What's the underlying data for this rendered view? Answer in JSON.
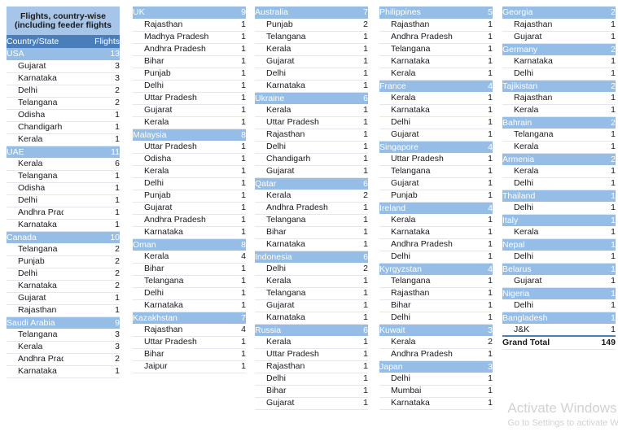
{
  "table": {
    "title_line_1": "Flights, country-wise",
    "title_line_2": "(including feeder flights",
    "header": {
      "label": "Country/State",
      "value": "Flights"
    },
    "grand_total": {
      "label": "Grand Total",
      "value": "149"
    },
    "colors": {
      "title_band": "#A7C5E8",
      "header_band": "#4A7EBB",
      "group_band": "#95BDE5",
      "detail_bg": "#FFFFFF",
      "row_rule": "#E3E8EE",
      "total_rule": "#4A7EBB",
      "watermark": "#D2D2D2"
    }
  },
  "watermark": {
    "line1": "Activate Windows",
    "line2": "Go to Settings to activate Windows."
  },
  "chart_data": {
    "type": "table",
    "title": "Flights, country-wise (including feeder flights",
    "columns": [
      "Country/State",
      "Flights"
    ],
    "grand_total": 149,
    "groups": [
      {
        "country": "USA",
        "total": 13,
        "states": [
          {
            "state": "Gujarat",
            "flights": 3
          },
          {
            "state": "Karnataka",
            "flights": 3
          },
          {
            "state": "Delhi",
            "flights": 2
          },
          {
            "state": "Telangana",
            "flights": 2
          },
          {
            "state": "Odisha",
            "flights": 1
          },
          {
            "state": "Chandigarh",
            "flights": 1
          },
          {
            "state": "Kerala",
            "flights": 1
          }
        ]
      },
      {
        "country": "UAE",
        "total": 11,
        "states": [
          {
            "state": "Kerala",
            "flights": 6
          },
          {
            "state": "Telangana",
            "flights": 1
          },
          {
            "state": "Odisha",
            "flights": 1
          },
          {
            "state": "Delhi",
            "flights": 1
          },
          {
            "state": "Andhra Pradesh",
            "flights": 1
          },
          {
            "state": "Karnataka",
            "flights": 1
          }
        ]
      },
      {
        "country": "Canada",
        "total": 10,
        "states": [
          {
            "state": "Telangana",
            "flights": 2
          },
          {
            "state": "Punjab",
            "flights": 2
          },
          {
            "state": "Delhi",
            "flights": 2
          },
          {
            "state": "Karnataka",
            "flights": 2
          },
          {
            "state": "Gujarat",
            "flights": 1
          },
          {
            "state": "Rajasthan",
            "flights": 1
          }
        ]
      },
      {
        "country": "Saudi Arabia",
        "total": 9,
        "states": [
          {
            "state": "Telangana",
            "flights": 3
          },
          {
            "state": "Kerala",
            "flights": 3
          },
          {
            "state": "Andhra Pradesh",
            "flights": 2
          },
          {
            "state": "Karnataka",
            "flights": 1
          }
        ]
      },
      {
        "country": "UK",
        "total": 9,
        "states": [
          {
            "state": "Rajasthan",
            "flights": 1
          },
          {
            "state": "Madhya Pradesh",
            "flights": 1
          },
          {
            "state": "Andhra Pradesh",
            "flights": 1
          },
          {
            "state": "Bihar",
            "flights": 1
          },
          {
            "state": "Punjab",
            "flights": 1
          },
          {
            "state": "Delhi",
            "flights": 1
          },
          {
            "state": "Uttar Pradesh",
            "flights": 1
          },
          {
            "state": "Gujarat",
            "flights": 1
          },
          {
            "state": "Kerala",
            "flights": 1
          }
        ]
      },
      {
        "country": "Malaysia",
        "total": 8,
        "states": [
          {
            "state": "Uttar Pradesh",
            "flights": 1
          },
          {
            "state": "Odisha",
            "flights": 1
          },
          {
            "state": "Kerala",
            "flights": 1
          },
          {
            "state": "Delhi",
            "flights": 1
          },
          {
            "state": "Punjab",
            "flights": 1
          },
          {
            "state": "Gujarat",
            "flights": 1
          },
          {
            "state": "Andhra Pradesh",
            "flights": 1
          },
          {
            "state": "Karnataka",
            "flights": 1
          }
        ]
      },
      {
        "country": "Oman",
        "total": 8,
        "states": [
          {
            "state": "Kerala",
            "flights": 4
          },
          {
            "state": "Bihar",
            "flights": 1
          },
          {
            "state": "Telangana",
            "flights": 1
          },
          {
            "state": "Delhi",
            "flights": 1
          },
          {
            "state": "Karnataka",
            "flights": 1
          }
        ]
      },
      {
        "country": "Kazakhstan",
        "total": 7,
        "states": [
          {
            "state": "Rajasthan",
            "flights": 4
          },
          {
            "state": "Uttar Pradesh",
            "flights": 1
          },
          {
            "state": "Bihar",
            "flights": 1
          },
          {
            "state": "Jaipur",
            "flights": 1
          }
        ]
      },
      {
        "country": "Australia",
        "total": 7,
        "states": [
          {
            "state": "Punjab",
            "flights": 2
          },
          {
            "state": "Telangana",
            "flights": 1
          },
          {
            "state": "Kerala",
            "flights": 1
          },
          {
            "state": "Gujarat",
            "flights": 1
          },
          {
            "state": "Delhi",
            "flights": 1
          },
          {
            "state": "Karnataka",
            "flights": 1
          }
        ]
      },
      {
        "country": "Ukraine",
        "total": 6,
        "states": [
          {
            "state": "Kerala",
            "flights": 1
          },
          {
            "state": "Uttar Pradesh",
            "flights": 1
          },
          {
            "state": "Rajasthan",
            "flights": 1
          },
          {
            "state": "Delhi",
            "flights": 1
          },
          {
            "state": "Chandigarh",
            "flights": 1
          },
          {
            "state": "Gujarat",
            "flights": 1
          }
        ]
      },
      {
        "country": "Qatar",
        "total": 6,
        "states": [
          {
            "state": "Kerala",
            "flights": 2
          },
          {
            "state": "Andhra Pradesh",
            "flights": 1
          },
          {
            "state": "Telangana",
            "flights": 1
          },
          {
            "state": "Bihar",
            "flights": 1
          },
          {
            "state": "Karnataka",
            "flights": 1
          }
        ]
      },
      {
        "country": "Indonesia",
        "total": 6,
        "states": [
          {
            "state": "Delhi",
            "flights": 2
          },
          {
            "state": "Kerala",
            "flights": 1
          },
          {
            "state": "Telangana",
            "flights": 1
          },
          {
            "state": "Gujarat",
            "flights": 1
          },
          {
            "state": "Karnataka",
            "flights": 1
          }
        ]
      },
      {
        "country": "Russia",
        "total": 6,
        "states": [
          {
            "state": "Kerala",
            "flights": 1
          },
          {
            "state": "Uttar Pradesh",
            "flights": 1
          },
          {
            "state": "Rajasthan",
            "flights": 1
          },
          {
            "state": "Delhi",
            "flights": 1
          },
          {
            "state": "Bihar",
            "flights": 1
          },
          {
            "state": "Gujarat",
            "flights": 1
          }
        ]
      },
      {
        "country": "Philippines",
        "total": 5,
        "states": [
          {
            "state": "Rajasthan",
            "flights": 1
          },
          {
            "state": "Andhra Pradesh",
            "flights": 1
          },
          {
            "state": "Telangana",
            "flights": 1
          },
          {
            "state": "Karnataka",
            "flights": 1
          },
          {
            "state": "Kerala",
            "flights": 1
          }
        ]
      },
      {
        "country": "France",
        "total": 4,
        "states": [
          {
            "state": "Kerala",
            "flights": 1
          },
          {
            "state": "Karnataka",
            "flights": 1
          },
          {
            "state": "Delhi",
            "flights": 1
          },
          {
            "state": "Gujarat",
            "flights": 1
          }
        ]
      },
      {
        "country": "Singapore",
        "total": 4,
        "states": [
          {
            "state": "Uttar Pradesh",
            "flights": 1
          },
          {
            "state": "Telangana",
            "flights": 1
          },
          {
            "state": "Gujarat",
            "flights": 1
          },
          {
            "state": "Punjab",
            "flights": 1
          }
        ]
      },
      {
        "country": "Ireland",
        "total": 4,
        "states": [
          {
            "state": "Kerala",
            "flights": 1
          },
          {
            "state": "Karnataka",
            "flights": 1
          },
          {
            "state": "Andhra Pradesh",
            "flights": 1
          },
          {
            "state": "Delhi",
            "flights": 1
          }
        ]
      },
      {
        "country": "Kyrgyzstan",
        "total": 4,
        "states": [
          {
            "state": "Telangana",
            "flights": 1
          },
          {
            "state": "Rajasthan",
            "flights": 1
          },
          {
            "state": "Bihar",
            "flights": 1
          },
          {
            "state": "Delhi",
            "flights": 1
          }
        ]
      },
      {
        "country": "Kuwait",
        "total": 3,
        "states": [
          {
            "state": "Kerala",
            "flights": 2
          },
          {
            "state": "Andhra Pradesh",
            "flights": 1
          }
        ]
      },
      {
        "country": "Japan",
        "total": 3,
        "states": [
          {
            "state": "Delhi",
            "flights": 1
          },
          {
            "state": "Mumbai",
            "flights": 1
          },
          {
            "state": "Karnataka",
            "flights": 1
          }
        ]
      },
      {
        "country": "Georgia",
        "total": 2,
        "states": [
          {
            "state": "Rajasthan",
            "flights": 1
          },
          {
            "state": "Gujarat",
            "flights": 1
          }
        ]
      },
      {
        "country": "Germany",
        "total": 2,
        "states": [
          {
            "state": "Karnataka",
            "flights": 1
          },
          {
            "state": "Delhi",
            "flights": 1
          }
        ]
      },
      {
        "country": "Tajikistan",
        "total": 2,
        "states": [
          {
            "state": "Rajasthan",
            "flights": 1
          },
          {
            "state": "Kerala",
            "flights": 1
          }
        ]
      },
      {
        "country": "Bahrain",
        "total": 2,
        "states": [
          {
            "state": "Telangana",
            "flights": 1
          },
          {
            "state": "Kerala",
            "flights": 1
          }
        ]
      },
      {
        "country": "Armenia",
        "total": 2,
        "states": [
          {
            "state": "Kerala",
            "flights": 1
          },
          {
            "state": "Delhi",
            "flights": 1
          }
        ]
      },
      {
        "country": "Thailand",
        "total": 1,
        "states": [
          {
            "state": "Delhi",
            "flights": 1
          }
        ]
      },
      {
        "country": "Italy",
        "total": 1,
        "states": [
          {
            "state": "Kerala",
            "flights": 1
          }
        ]
      },
      {
        "country": "Nepal",
        "total": 1,
        "states": [
          {
            "state": "Delhi",
            "flights": 1
          }
        ]
      },
      {
        "country": "Belarus",
        "total": 1,
        "states": [
          {
            "state": "Gujarat",
            "flights": 1
          }
        ]
      },
      {
        "country": "Nigeria",
        "total": 1,
        "states": [
          {
            "state": "Delhi",
            "flights": 1
          }
        ]
      },
      {
        "country": "Bangladesh",
        "total": 1,
        "states": [
          {
            "state": "J&K",
            "flights": 1
          }
        ]
      }
    ]
  },
  "layout": {
    "columns": [
      {
        "groups": [
          0,
          1,
          2,
          3
        ],
        "show_title": true,
        "show_header": true,
        "show_total": false
      },
      {
        "groups": [
          4,
          5,
          6,
          7
        ],
        "show_title": false,
        "show_header": false,
        "show_total": false
      },
      {
        "groups": [
          8,
          9,
          10,
          11,
          12
        ],
        "show_title": false,
        "show_header": false,
        "show_total": false
      },
      {
        "groups": [
          13,
          14,
          15,
          16,
          17,
          18,
          19
        ],
        "show_title": false,
        "show_header": false,
        "show_total": false
      },
      {
        "groups": [
          20,
          21,
          22,
          23,
          24,
          25,
          26,
          27,
          28,
          29,
          30
        ],
        "show_title": false,
        "show_header": false,
        "show_total": true
      }
    ]
  }
}
